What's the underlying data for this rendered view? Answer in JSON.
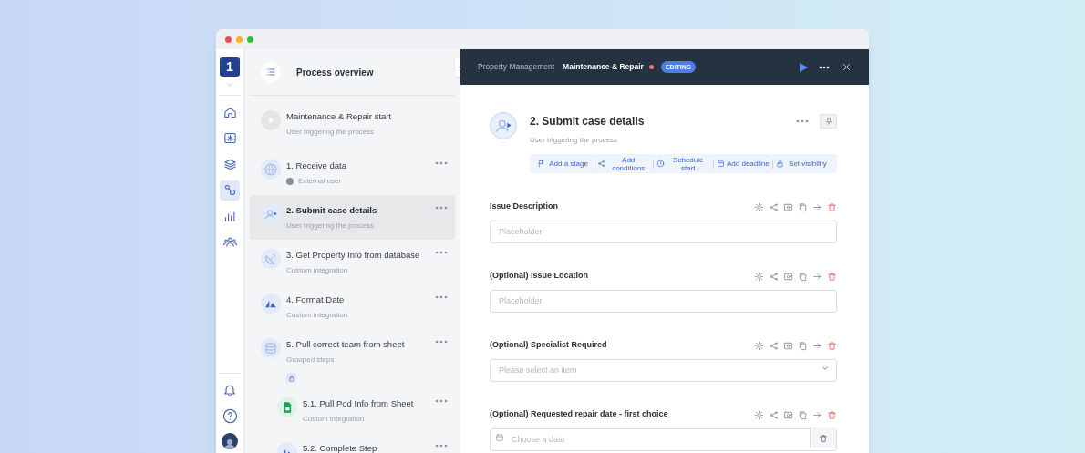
{
  "sidebar": {
    "logo": "1",
    "items": [
      {
        "kind": "home",
        "selected": false
      },
      {
        "kind": "inbox",
        "selected": false
      },
      {
        "kind": "layers",
        "selected": false
      },
      {
        "kind": "process",
        "selected": true
      },
      {
        "kind": "chart",
        "selected": false
      },
      {
        "kind": "people",
        "selected": false
      }
    ]
  },
  "steps_panel": {
    "title": "Process overview",
    "steps": [
      {
        "kind": "start",
        "title": "Maintenance & Repair start",
        "subtitle": "User triggering the process",
        "selected": false,
        "menu": false
      },
      {
        "kind": "web",
        "title": "1. Receive data",
        "subtitle": "External user",
        "selected": false,
        "menu": true
      },
      {
        "kind": "form",
        "title": "2. Submit case details",
        "subtitle": "User triggering the process",
        "selected": true,
        "menu": true
      },
      {
        "kind": "integration",
        "title": "3. Get Property Info from database",
        "subtitle": "Custom integration",
        "selected": false,
        "menu": true
      },
      {
        "kind": "formatter",
        "title": "4. Format Date",
        "subtitle": "Custom integration",
        "selected": false,
        "menu": true
      },
      {
        "kind": "group",
        "title": "5. Pull correct team from sheet",
        "subtitle": "Grouped steps",
        "selected": false,
        "menu": true,
        "locked": true,
        "children": [
          {
            "kind": "sheet",
            "title": "5.1. Pull Pod Info from Sheet",
            "subtitle": "Custom integration",
            "selected": false,
            "menu": true
          },
          {
            "kind": "formatter",
            "title": "5.2. Complete Step",
            "selected": false,
            "menu": true
          }
        ]
      }
    ]
  },
  "header": {
    "breadcrumb": "Property Management",
    "process": "Maintenance & Repair",
    "unsaved": true,
    "badge": "EDITING"
  },
  "step": {
    "title": "2. Submit case details",
    "subtitle": "User triggering the process",
    "actions": [
      {
        "kind": "flag",
        "label": "Add a stage"
      },
      {
        "kind": "share",
        "label": "Add conditions"
      },
      {
        "kind": "clock",
        "label": "Schedule start"
      },
      {
        "kind": "calendar",
        "label": "Add deadline"
      },
      {
        "kind": "lock",
        "label": "Set visibility"
      }
    ]
  },
  "fields": [
    {
      "kind": "text",
      "label": "Issue Description",
      "placeholder": "Placeholder"
    },
    {
      "kind": "text",
      "label": "(Optional) Issue Location",
      "placeholder": "Placeholder"
    },
    {
      "kind": "select",
      "label": "(Optional) Specialist Required",
      "placeholder": "Please select an item"
    },
    {
      "kind": "date",
      "label": "(Optional) Requested repair date - first choice",
      "placeholder": "Choose a date"
    }
  ]
}
